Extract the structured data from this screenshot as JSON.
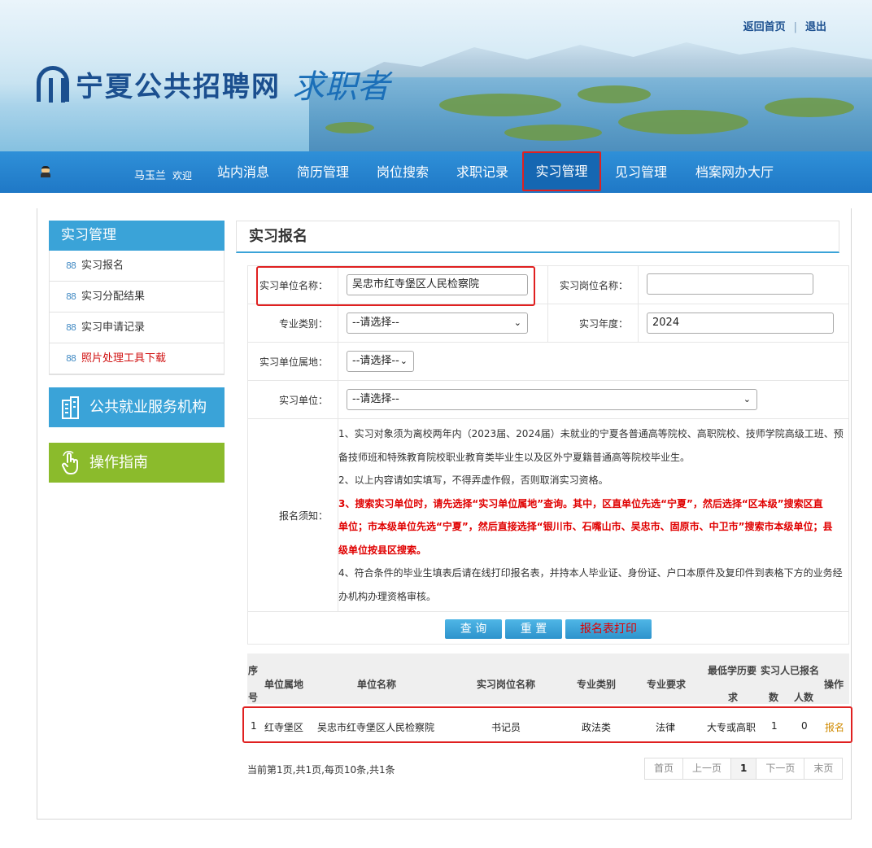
{
  "header": {
    "site_name": "宁夏公共招聘网",
    "site_sub": "求职者",
    "links": [
      "返回首页",
      "退出"
    ],
    "separator": "|"
  },
  "nav": {
    "user": "马玉兰",
    "welcome": "欢迎",
    "items": [
      "站内消息",
      "简历管理",
      "岗位搜索",
      "求职记录",
      "实习管理",
      "见习管理",
      "档案网办大厅"
    ],
    "active": "实习管理"
  },
  "sidebar": {
    "title": "实习管理",
    "items": [
      {
        "label": "实习报名"
      },
      {
        "label": "实习分配结果"
      },
      {
        "label": "实习申请记录"
      },
      {
        "label": "照片处理工具下载"
      }
    ],
    "blocks": [
      "公共就业服务机构",
      "操作指南"
    ]
  },
  "page": {
    "title": "实习报名"
  },
  "form": {
    "unit_name_label": "实习单位名称：",
    "unit_name_value": "吴忠市红寺堡区人民检察院",
    "post_name_label": "实习岗位名称：",
    "post_name_value": "",
    "major_label": "专业类别：",
    "major_value": "--请选择--",
    "year_label": "实习年度：",
    "year_value": "2024",
    "location_label": "实习单位属地：",
    "location_value": "--请选择--",
    "unit_label": "实习单位：",
    "unit_value": "--请选择--",
    "notes_label": "报名须知：",
    "notes": {
      "n1a": "1、实习对象须为离校两年内（2023届、2024届）未就业的宁夏各普通高等院校、高职院校、技师学院高级工班、预",
      "n1b": "备技师班和特殊教育院校职业教育类毕业生以及区外宁夏籍普通高等院校毕业生。",
      "n2": "2、以上内容请如实填写，不得弄虚作假，否则取消实习资格。",
      "n3a": "3、搜索实习单位时，请先选择“实习单位属地”查询。其中，区直单位先选“宁夏”，然后选择“区本级”搜索区直",
      "n3b": "单位；市本级单位先选“宁夏”，然后直接选择“银川市、石嘴山市、吴忠市、固原市、中卫市”搜索市本级单位；县",
      "n3c": "级单位按县区搜索。",
      "n4a": "4、符合条件的毕业生填表后请在线打印报名表，并持本人毕业证、身份证、户口本原件及复印件到表格下方的业务经",
      "n4b": "办机构办理资格审核。"
    },
    "buttons": {
      "query": "查 询",
      "reset": "重 置",
      "print": "报名表打印"
    }
  },
  "results": {
    "headers": {
      "seq_top": "序",
      "seq_bottom": "号",
      "location": "单位属地",
      "unit": "单位名称",
      "post": "实习岗位名称",
      "major": "专业类别",
      "req": "专业要求",
      "edu_top": "最低学历要",
      "edu_bottom": "求",
      "count_top": "实习人",
      "count_bottom": "数",
      "signed_top": "已报名",
      "signed_bottom": "人数",
      "op": "操作"
    },
    "rows": [
      {
        "seq": "1",
        "location": "红寺堡区",
        "unit": "吴忠市红寺堡区人民检察院",
        "post": "书记员",
        "major": "政法类",
        "req": "法律",
        "edu": "大专或高职",
        "count": "1",
        "signed": "0",
        "op": "报名"
      }
    ]
  },
  "pagination": {
    "info": "当前第1页,共1页,每页10条,共1条",
    "first": "首页",
    "prev": "上一页",
    "current": "1",
    "next": "下一页",
    "last": "末页"
  },
  "colors": {
    "accent": "#3aa3d8",
    "nav": "#1f78c6",
    "highlight": "#e02020",
    "green": "#8bbb2c"
  }
}
